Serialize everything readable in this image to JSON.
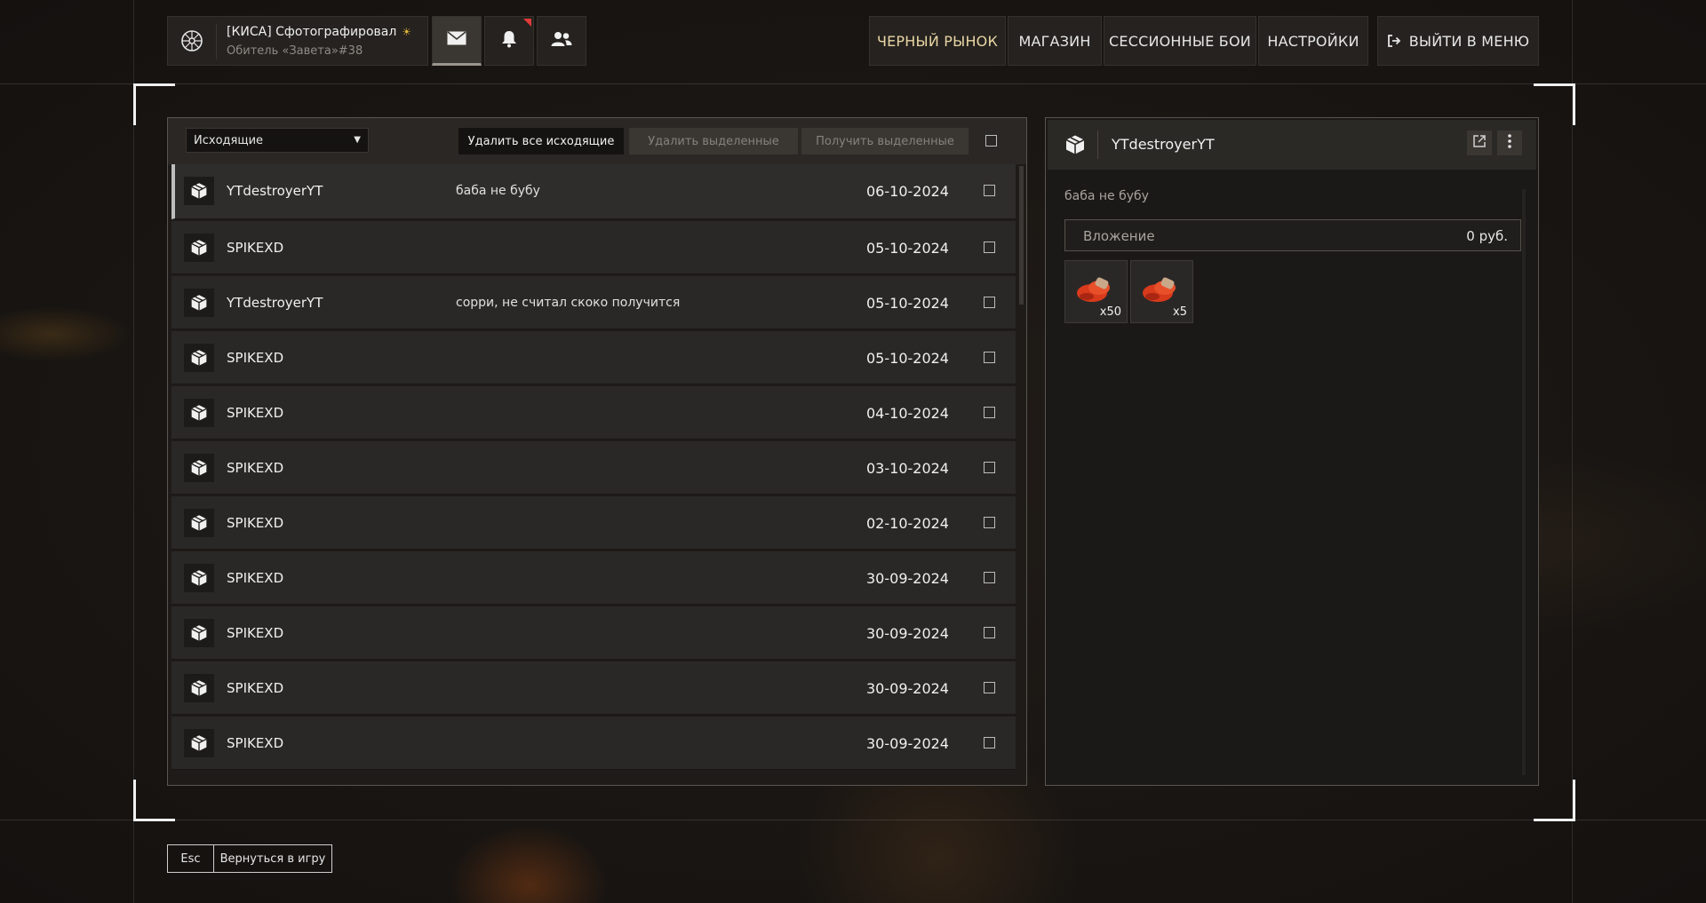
{
  "profile": {
    "name": "[КИСА] Сфотографировал",
    "clan": "Обитель «Завета»#38",
    "badge_icon": "sun-badge-icon"
  },
  "top_icons": [
    "mail-icon",
    "bell-icon",
    "friends-icon"
  ],
  "nav": {
    "black_market": "ЧЕРНЫЙ РЫНОК",
    "shop": "МАГАЗИН",
    "session_battles": "СЕССИОННЫЕ БОИ",
    "settings": "НАСТРОЙКИ",
    "exit": "ВЫЙТИ В МЕНЮ"
  },
  "mail": {
    "folder": "Исходящие",
    "delete_all": "Удалить все исходящие",
    "delete_selected": "Удалить выделенные",
    "receive_selected": "Получить выделенные",
    "messages": [
      {
        "sender": "YTdestroyerYT",
        "subject": "баба не бубу",
        "date": "06-10-2024"
      },
      {
        "sender": "SPIKEXD",
        "subject": "",
        "date": "05-10-2024"
      },
      {
        "sender": "YTdestroyerYT",
        "subject": "сорри, не считал скоко получится",
        "date": "05-10-2024"
      },
      {
        "sender": "SPIKEXD",
        "subject": "",
        "date": "05-10-2024"
      },
      {
        "sender": "SPIKEXD",
        "subject": "",
        "date": "04-10-2024"
      },
      {
        "sender": "SPIKEXD",
        "subject": "",
        "date": "03-10-2024"
      },
      {
        "sender": "SPIKEXD",
        "subject": "",
        "date": "02-10-2024"
      },
      {
        "sender": "SPIKEXD",
        "subject": "",
        "date": "30-09-2024"
      },
      {
        "sender": "SPIKEXD",
        "subject": "",
        "date": "30-09-2024"
      },
      {
        "sender": "SPIKEXD",
        "subject": "",
        "date": "30-09-2024"
      },
      {
        "sender": "SPIKEXD",
        "subject": "",
        "date": "30-09-2024"
      }
    ]
  },
  "detail": {
    "sender": "YTdestroyerYT",
    "body": "баба не бубу",
    "attachment_label": "Вложение",
    "attachment_amount": "0 руб.",
    "items": [
      {
        "icon": "red-ammo-icon",
        "qty": "x50"
      },
      {
        "icon": "red-ammo-icon",
        "qty": "x5"
      }
    ]
  },
  "footer": {
    "key": "Esc",
    "label": "Вернуться в игру"
  }
}
